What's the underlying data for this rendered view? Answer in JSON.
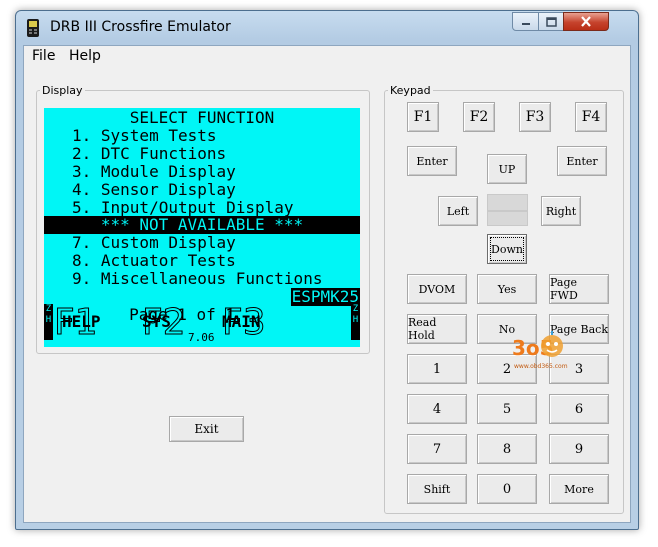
{
  "window": {
    "title": "DRB III Crossfire Emulator"
  },
  "menu": [
    "File",
    "Help"
  ],
  "display": {
    "group_label": "Display",
    "heading": "SELECT FUNCTION",
    "items": [
      "1. System Tests",
      "2. DTC Functions",
      "3. Module Display",
      "4. Sensor Display",
      "5. Input/Output Display",
      "*** NOT AVAILABLE ***",
      "7. Custom Display",
      "8. Actuator Tests",
      "9. Miscellaneous Functions"
    ],
    "page": "Page 1 of 1",
    "module_code": "ESPMK25",
    "side_left": "Z\nH",
    "side_right": "Z\nH",
    "fkeys": [
      {
        "key": "F1",
        "label": "HELP"
      },
      {
        "key": "F2",
        "label": "SYS"
      },
      {
        "key": "F3",
        "label": "MAIN"
      }
    ],
    "version": "7.06"
  },
  "exit_label": "Exit",
  "keypad": {
    "group_label": "Keypad",
    "fkeys": [
      "F1",
      "F2",
      "F3",
      "F4"
    ],
    "enter_left": "Enter",
    "up": "UP",
    "enter_right": "Enter",
    "left": "Left",
    "right": "Right",
    "down": "Down",
    "row1": [
      "DVOM",
      "Yes",
      "Page FWD"
    ],
    "row2": [
      "Read Hold",
      "No",
      "Page Back"
    ],
    "row3": [
      "1",
      "2",
      "3"
    ],
    "row4": [
      "4",
      "5",
      "6"
    ],
    "row5": [
      "7",
      "8",
      "9"
    ],
    "row6": [
      "Shift",
      "0",
      "More"
    ]
  },
  "watermark": {
    "text": "3o5",
    "sub": "www.obd365.com"
  },
  "colors": {
    "screen": "#00f6f6",
    "close_button": "#c6432d",
    "logo": "#ee7a1c"
  }
}
